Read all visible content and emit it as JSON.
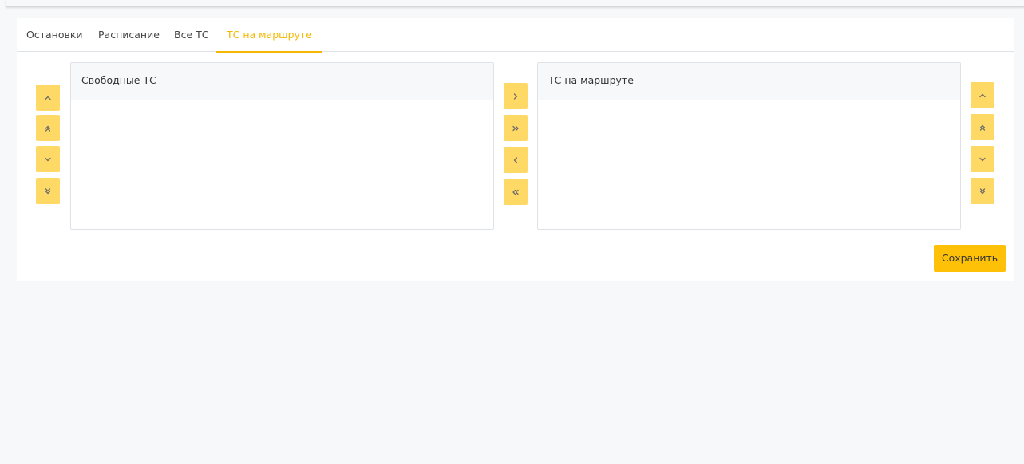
{
  "tabs": [
    {
      "label": "Остановки",
      "active": false
    },
    {
      "label": "Расписание",
      "active": false
    },
    {
      "label": "Все ТС",
      "active": false
    },
    {
      "label": "ТС на маршруте",
      "active": true
    }
  ],
  "left_panel": {
    "title": "Свободные ТС",
    "items": []
  },
  "right_panel": {
    "title": "ТС на маршруте",
    "items": []
  },
  "save_label": "Сохранить",
  "colors": {
    "accent": "#ffc107",
    "button_light": "#ffd966",
    "active_tab": "#f5b800"
  },
  "left_controls": [
    "chevron-up-icon",
    "double-chevron-up-icon",
    "chevron-down-icon",
    "double-chevron-down-icon"
  ],
  "transfer_controls": [
    "chevron-right-icon",
    "double-chevron-right-icon",
    "chevron-left-icon",
    "double-chevron-left-icon"
  ],
  "right_controls": [
    "chevron-up-icon",
    "double-chevron-up-icon",
    "chevron-down-icon",
    "double-chevron-down-icon"
  ]
}
